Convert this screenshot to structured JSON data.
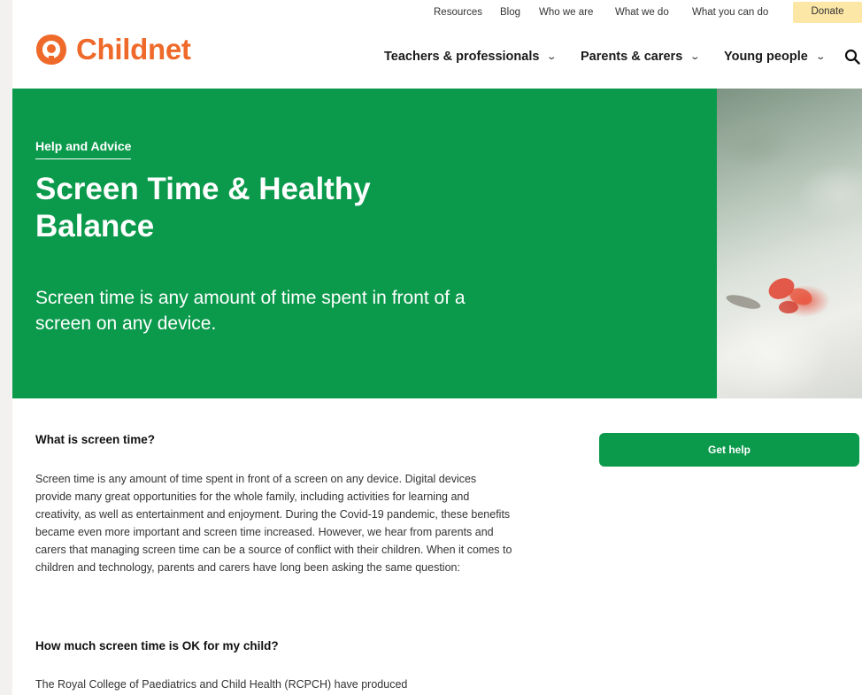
{
  "utility_nav": [
    "Resources",
    "Blog",
    "Who we are",
    "What we do",
    "What you can do"
  ],
  "donate_label": "Donate",
  "logo": {
    "text": "Childnet",
    "color": "#ef6a2a"
  },
  "main_nav": [
    "Teachers & professionals",
    "Parents & carers",
    "Young people"
  ],
  "hero": {
    "eyebrow": "Help and Advice",
    "title": "Screen Time & Healthy Balance",
    "subtitle": "Screen time is any amount of time spent in front of a screen on any device.",
    "background": "#0b9a4c"
  },
  "sidebar": {
    "cta_label": "Get help"
  },
  "content": {
    "section1_heading": "What is screen time?",
    "section1_body": "Screen time is any amount of time spent in front of a screen on any device. Digital devices provide many great opportunities for the whole family, including activities for learning and creativity, as well as entertainment and enjoyment. During the Covid-19 pandemic, these benefits became even more important and screen time increased. However, we hear from parents and carers that managing screen time can be a source of conflict with their children. When it comes to children and technology, parents and carers have long been asking the same question:",
    "section2_heading": "How much screen time is OK for my child?",
    "section2_body": "The Royal College of Paediatrics and Child Health (RCPCH) have produced"
  }
}
